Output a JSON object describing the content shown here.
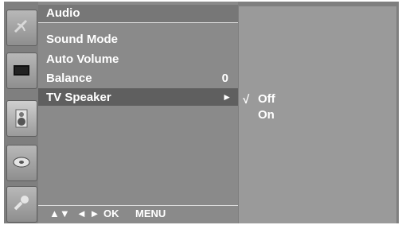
{
  "menu": {
    "title": "Audio",
    "items": [
      {
        "label": "Sound Mode",
        "value": ""
      },
      {
        "label": "Auto Volume",
        "value": ""
      },
      {
        "label": "Balance",
        "value": "0"
      },
      {
        "label": "TV Speaker",
        "value": ""
      }
    ],
    "selected_index": 3,
    "submenu_arrow": "►"
  },
  "submenu": {
    "check_mark": "√",
    "options": [
      "Off",
      "On"
    ],
    "selected": "Off"
  },
  "footer": {
    "updown": "▲▼",
    "leftright": "◄ ►",
    "ok": "OK",
    "menu": "MENU"
  },
  "icons": [
    "satellite-dish-icon",
    "monitor-icon",
    "speaker-icon",
    "disc-icon",
    "key-icon"
  ],
  "colors": {
    "menu_bg": "#8a8a8a",
    "selected_row": "#5f5f5f",
    "submenu_bg": "#9a9a9a",
    "text": "#ffffff"
  }
}
